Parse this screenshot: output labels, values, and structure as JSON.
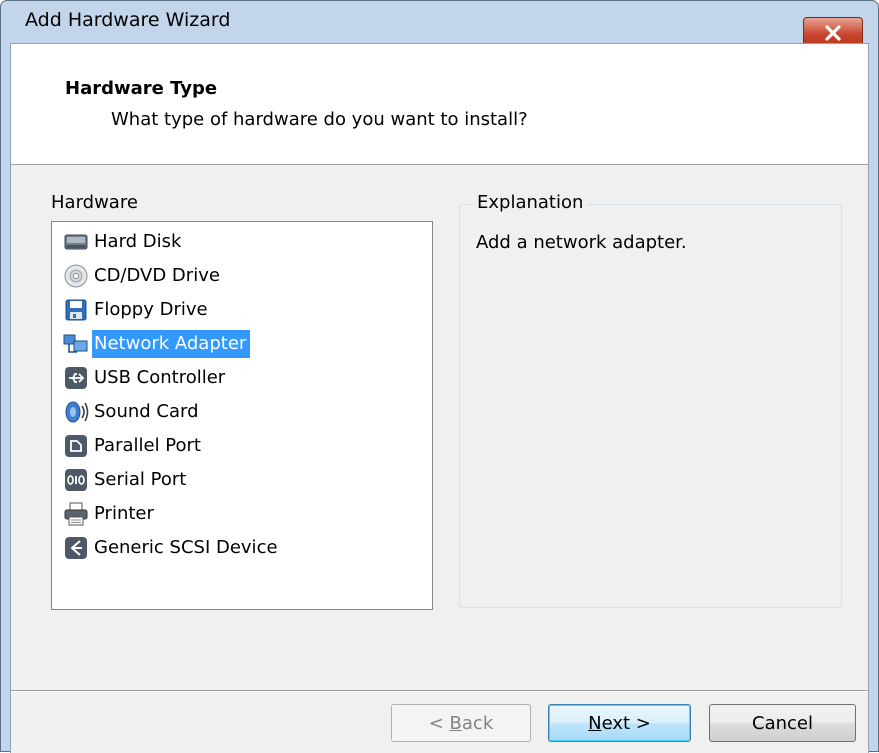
{
  "window": {
    "title": "Add Hardware Wizard"
  },
  "header": {
    "title": "Hardware Type",
    "subtitle": "What type of hardware do you want to install?"
  },
  "hardware": {
    "label": "Hardware",
    "selected_index": 3,
    "items": [
      {
        "label": "Hard Disk",
        "icon": "hard-disk-icon"
      },
      {
        "label": "CD/DVD Drive",
        "icon": "cd-dvd-icon"
      },
      {
        "label": "Floppy Drive",
        "icon": "floppy-icon"
      },
      {
        "label": "Network Adapter",
        "icon": "network-adapter-icon"
      },
      {
        "label": "USB Controller",
        "icon": "usb-icon"
      },
      {
        "label": "Sound Card",
        "icon": "sound-card-icon"
      },
      {
        "label": "Parallel Port",
        "icon": "parallel-port-icon"
      },
      {
        "label": "Serial Port",
        "icon": "serial-port-icon"
      },
      {
        "label": "Printer",
        "icon": "printer-icon"
      },
      {
        "label": "Generic SCSI Device",
        "icon": "scsi-device-icon"
      }
    ]
  },
  "explanation": {
    "label": "Explanation",
    "text": "Add a network adapter."
  },
  "buttons": {
    "back_prefix": "< ",
    "back_mnemonic": "B",
    "back_rest": "ack",
    "next_mnemonic": "N",
    "next_rest": "ext >",
    "cancel": "Cancel"
  },
  "colors": {
    "selection": "#3399ff",
    "titlebar": "#c3d5ea",
    "close_button": "#c8452d"
  }
}
